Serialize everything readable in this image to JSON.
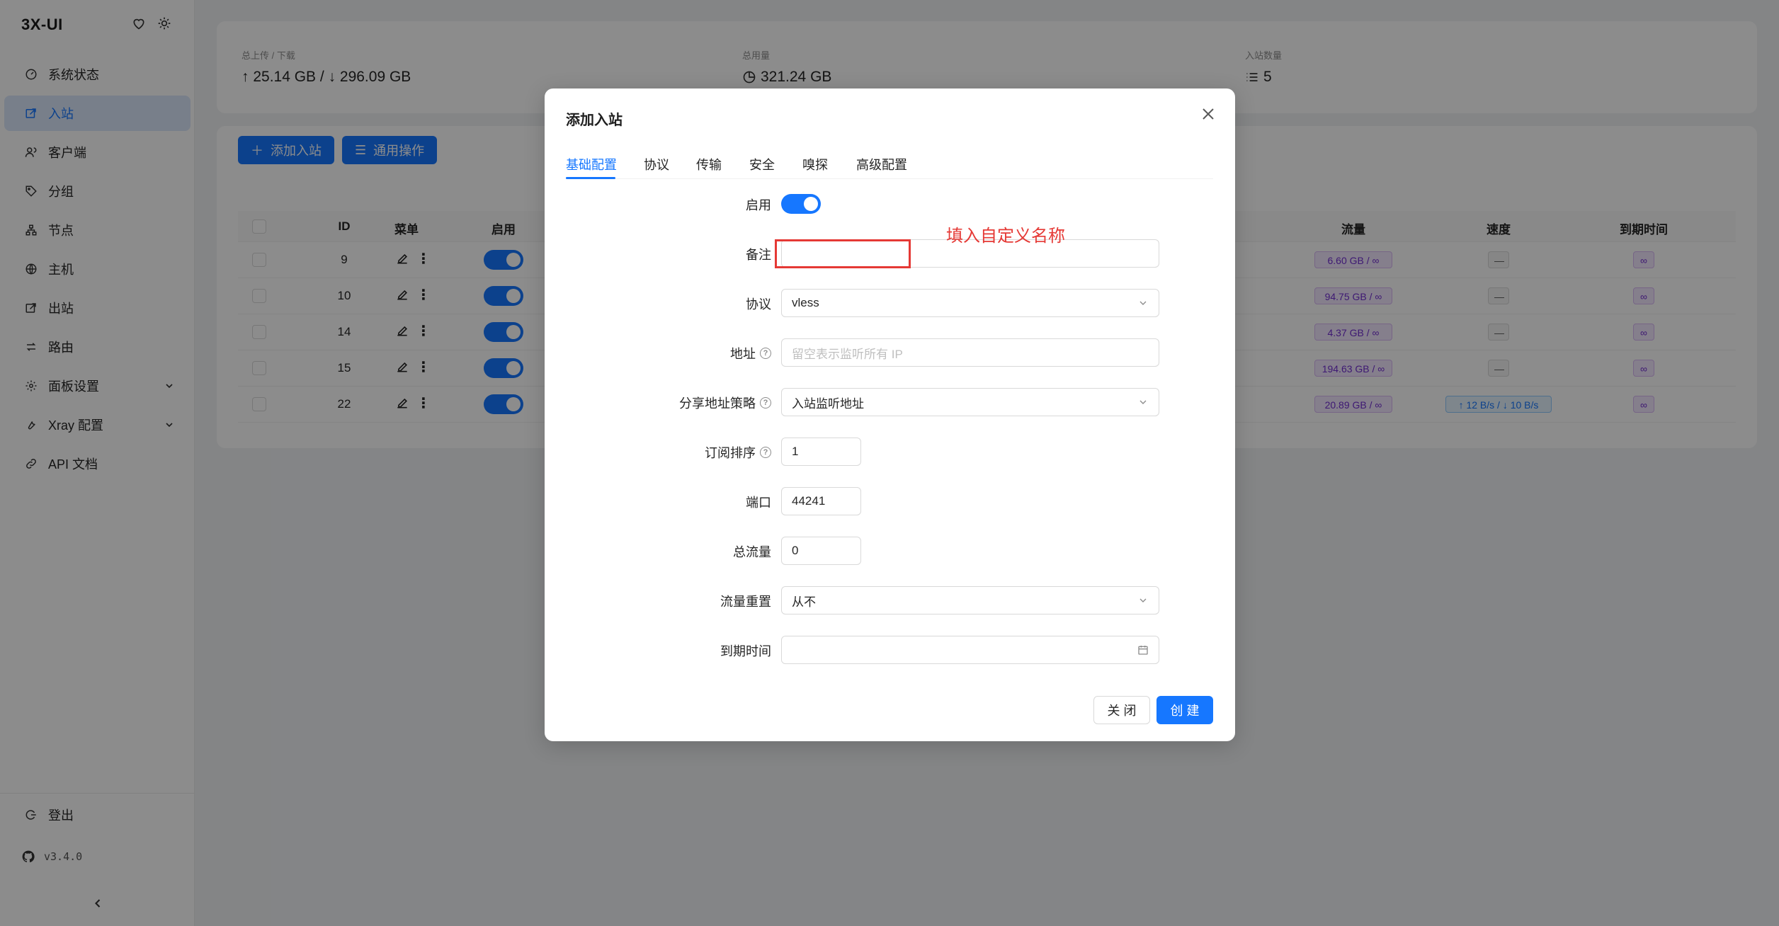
{
  "app": {
    "title": "3X-UI",
    "version": "v3.4.0"
  },
  "sidebar": {
    "items": [
      {
        "label": "系统状态",
        "icon": "dashboard-icon"
      },
      {
        "label": "入站",
        "icon": "inbound-icon",
        "active": true
      },
      {
        "label": "客户端",
        "icon": "users-icon"
      },
      {
        "label": "分组",
        "icon": "tag-icon"
      },
      {
        "label": "节点",
        "icon": "nodes-icon"
      },
      {
        "label": "主机",
        "icon": "globe-icon"
      },
      {
        "label": "出站",
        "icon": "outbound-icon"
      },
      {
        "label": "路由",
        "icon": "route-icon"
      },
      {
        "label": "面板设置",
        "icon": "settings-icon",
        "expandable": true
      },
      {
        "label": "Xray 配置",
        "icon": "tool-icon",
        "expandable": true
      },
      {
        "label": "API 文档",
        "icon": "api-icon"
      }
    ],
    "logout": "登出"
  },
  "stats": {
    "traffic_label": "总上传 / 下载",
    "traffic_value": "↑ 25.14 GB / ↓ 296.09 GB",
    "usage_label": "总用量",
    "usage_value": "321.24 GB",
    "inbound_count_label": "入站数量",
    "inbound_count_value": "5"
  },
  "toolbar": {
    "add_inbound": "添加入站",
    "general_actions": "通用操作"
  },
  "table": {
    "headers": {
      "id": "ID",
      "menu": "菜单",
      "enabled": "启用",
      "traffic": "流量",
      "speed": "速度",
      "expiry": "到期时间"
    },
    "rows": [
      {
        "id": "9",
        "traffic": "6.60 GB / ∞",
        "speed": "—",
        "expiry": "∞"
      },
      {
        "id": "10",
        "traffic": "94.75 GB / ∞",
        "speed": "—",
        "expiry": "∞"
      },
      {
        "id": "14",
        "traffic": "4.37 GB / ∞",
        "speed": "—",
        "expiry": "∞"
      },
      {
        "id": "15",
        "traffic": "194.63 GB / ∞",
        "speed": "—",
        "expiry": "∞"
      },
      {
        "id": "22",
        "traffic": "20.89 GB / ∞",
        "speed": "↑ 12 B/s / ↓ 10 B/s",
        "expiry": "∞"
      }
    ]
  },
  "modal": {
    "title": "添加入站",
    "tabs": [
      "基础配置",
      "协议",
      "传输",
      "安全",
      "嗅探",
      "高级配置"
    ],
    "fields": {
      "enable_label": "启用",
      "remark_label": "备注",
      "remark_value": "",
      "protocol_label": "协议",
      "protocol_value": "vless",
      "address_label": "地址",
      "address_placeholder": "留空表示监听所有 IP",
      "share_label": "分享地址策略",
      "share_value": "入站监听地址",
      "sub_order_label": "订阅排序",
      "sub_order_value": "1",
      "port_label": "端口",
      "port_value": "44241",
      "total_label": "总流量",
      "total_value": "0",
      "reset_label": "流量重置",
      "reset_value": "从不",
      "expiry_label": "到期时间"
    },
    "close_button": "关 闭",
    "create_button": "创 建"
  },
  "annotation": {
    "text": "填入自定义名称",
    "color": "#e53935"
  },
  "colors": {
    "primary": "#1677ff",
    "annotation": "#e53935"
  }
}
